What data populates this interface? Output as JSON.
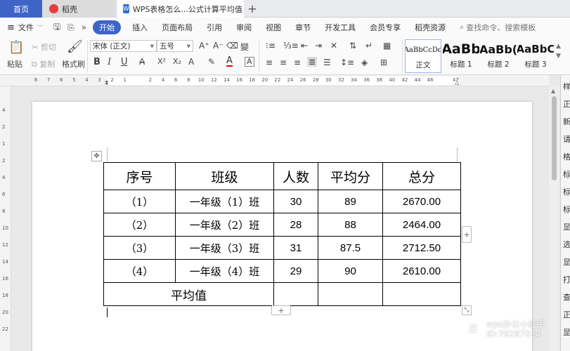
{
  "tabs": {
    "home": "首页",
    "docer": "稻壳",
    "document": "WPS表格怎么...公式计算平均值",
    "add": "+"
  },
  "menu": {
    "file": "文件",
    "start": "开始",
    "items": [
      "插入",
      "页面布局",
      "引用",
      "审阅",
      "视图",
      "章节",
      "开发工具",
      "会员专享",
      "稻壳资源"
    ],
    "search": "查找命令、搜索模板"
  },
  "ribbon": {
    "paste": "粘贴",
    "cut": "剪切",
    "copy": "复制",
    "format_painter": "格式刷",
    "font_name": "宋体 (正文)",
    "font_size": "五号",
    "bold": "B",
    "italic": "I",
    "underline": "U",
    "styles": [
      {
        "sample": "AaBbCcDd",
        "label": "正文"
      },
      {
        "sample": "AaBb",
        "label": "标题 1"
      },
      {
        "sample": "AaBb(",
        "label": "标题 2"
      },
      {
        "sample": "AaBbC",
        "label": "标题 3"
      }
    ]
  },
  "ruler_numbers": [
    "8",
    "7",
    "6",
    "5",
    "4",
    "3",
    "2",
    "1",
    "",
    "2",
    "4",
    "6",
    "8",
    "10",
    "12",
    "14",
    "16",
    "18",
    "20",
    "22",
    "24",
    "26",
    "28",
    "30",
    "32",
    "34",
    "36",
    "38",
    "40",
    "42",
    "44",
    "46",
    "",
    "47"
  ],
  "vruler_numbers": [
    "4",
    "2",
    "1",
    "2",
    "4",
    "6",
    "8",
    "10",
    "12",
    "14",
    "16",
    "18",
    "20",
    "22"
  ],
  "right_pane_chars": [
    "样",
    "正",
    "新",
    "请",
    "格",
    "标",
    "标",
    "标",
    "显",
    "选",
    "显",
    "打",
    "查",
    "正",
    "显"
  ],
  "table": {
    "headers": [
      "序号",
      "班级",
      "人数",
      "平均分",
      "总分"
    ],
    "rows": [
      [
        "（1）",
        "一年级（1）班",
        "30",
        "89",
        "2670.00"
      ],
      [
        "（2）",
        "一年级（2）班",
        "28",
        "88",
        "2464.00"
      ],
      [
        "（3）",
        "一年级（3）班",
        "31",
        "87.5",
        "2712.50"
      ],
      [
        "（4）",
        "一年级（4）班",
        "29",
        "90",
        "2610.00"
      ]
    ],
    "footer_label": "平均值"
  },
  "watermark": {
    "line1": "wps办公小能手",
    "line2": "ID:79287034"
  },
  "colors": {
    "accent": "#3e64c8",
    "tab_bg": "#e8eaed"
  }
}
